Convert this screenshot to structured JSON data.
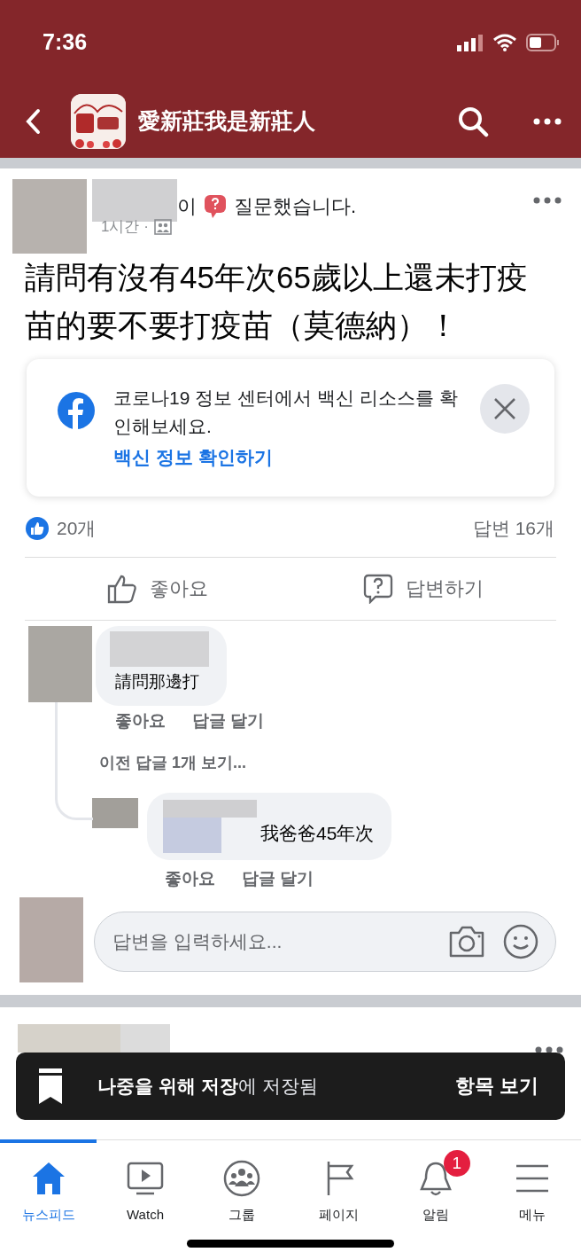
{
  "status_bar": {
    "time": "7:36"
  },
  "header": {
    "title": "愛新莊我是新莊人"
  },
  "post": {
    "author_suffix": "이",
    "action": "질문했습니다.",
    "time": "1시간 ·",
    "text": "請問有沒有45年次65歲以上還未打疫苗的要不要打疫苗（莫德納）！",
    "info_card": {
      "text": "코로나19 정보 센터에서 백신 리소스를 확인해보세요.",
      "link": "백신 정보 확인하기"
    },
    "likes": "20개",
    "answers": "답변 16개",
    "actions": [
      {
        "label": "좋아요",
        "kind": "like"
      },
      {
        "label": "답변하기",
        "kind": "answer"
      }
    ],
    "comments": [
      {
        "text": "請問那邊打",
        "actions": [
          "좋아요",
          "답글 달기"
        ],
        "more_replies": "이전 답글 1개 보기...",
        "replies": [
          {
            "text": "我爸爸45年次",
            "actions": [
              "좋아요",
              "답글 달기"
            ]
          }
        ]
      }
    ],
    "reply_field": {
      "placeholder": "답변을 입력하세요..."
    }
  },
  "toast": {
    "text": "**나중을 위해 저장**에 저장됨",
    "action": "항목 보기"
  },
  "tabs": [
    {
      "label": "뉴스피드",
      "kind": "home",
      "selected": true
    },
    {
      "label": "Watch",
      "kind": "watch",
      "selected": false
    },
    {
      "label": "그룹",
      "kind": "groups",
      "selected": false
    },
    {
      "label": "페이지",
      "kind": "pages",
      "selected": false
    },
    {
      "label": "알림",
      "kind": "bell",
      "selected": false,
      "badge": "1"
    },
    {
      "label": "메뉴",
      "kind": "menu",
      "selected": false
    }
  ]
}
